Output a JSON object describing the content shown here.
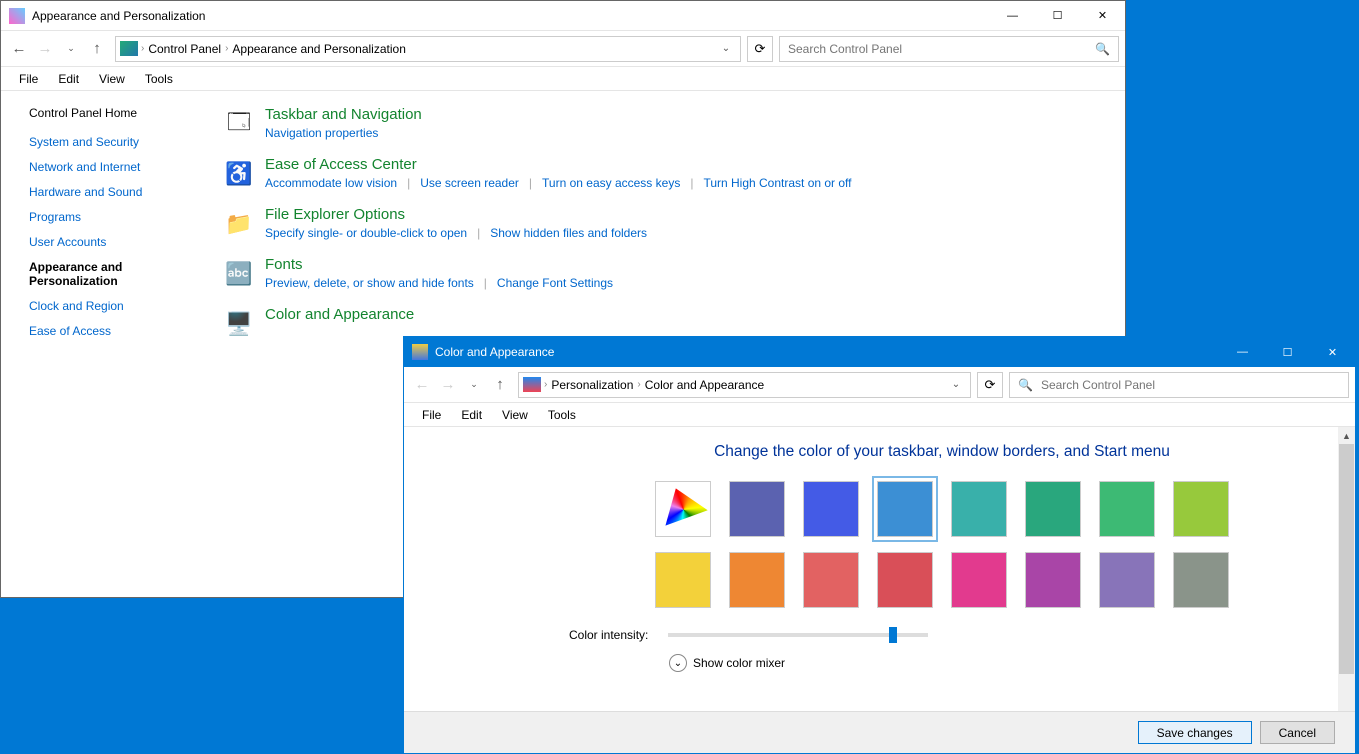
{
  "main_window": {
    "title": "Appearance and Personalization",
    "breadcrumb": {
      "root": "Control Panel",
      "current": "Appearance and Personalization"
    },
    "search_placeholder": "Search Control Panel",
    "menu": {
      "file": "File",
      "edit": "Edit",
      "view": "View",
      "tools": "Tools"
    },
    "sidebar": {
      "home": "Control Panel Home",
      "items": [
        "System and Security",
        "Network and Internet",
        "Hardware and Sound",
        "Programs",
        "User Accounts",
        "Appearance and Personalization",
        "Clock and Region",
        "Ease of Access"
      ]
    },
    "categories": [
      {
        "title": "Taskbar and Navigation",
        "links": [
          "Navigation properties"
        ]
      },
      {
        "title": "Ease of Access Center",
        "links": [
          "Accommodate low vision",
          "Use screen reader",
          "Turn on easy access keys",
          "Turn High Contrast on or off"
        ]
      },
      {
        "title": "File Explorer Options",
        "links": [
          "Specify single- or double-click to open",
          "Show hidden files and folders"
        ]
      },
      {
        "title": "Fonts",
        "links": [
          "Preview, delete, or show and hide fonts",
          "Change Font Settings"
        ]
      },
      {
        "title": "Color and Appearance",
        "links": []
      }
    ]
  },
  "sub_window": {
    "title": "Color and Appearance",
    "breadcrumb": {
      "seg1": "Personalization",
      "seg2": "Color and Appearance"
    },
    "search_placeholder": "Search Control Panel",
    "menu": {
      "file": "File",
      "edit": "Edit",
      "view": "View",
      "tools": "Tools"
    },
    "heading": "Change the color of your taskbar, window borders, and Start menu",
    "swatches": [
      {
        "name": "automatic",
        "color": "auto"
      },
      {
        "name": "indigo",
        "color": "#5b62b0"
      },
      {
        "name": "blue",
        "color": "#445be6"
      },
      {
        "name": "sky-blue",
        "color": "#3c8fd4",
        "selected": true
      },
      {
        "name": "teal",
        "color": "#39b0aa"
      },
      {
        "name": "sea-green",
        "color": "#29a77d"
      },
      {
        "name": "green",
        "color": "#3dba74"
      },
      {
        "name": "lime",
        "color": "#97c93c"
      },
      {
        "name": "yellow",
        "color": "#f3d13a"
      },
      {
        "name": "orange",
        "color": "#ee8733"
      },
      {
        "name": "coral",
        "color": "#e26262"
      },
      {
        "name": "red",
        "color": "#d94f58"
      },
      {
        "name": "magenta",
        "color": "#e23a8e"
      },
      {
        "name": "purple",
        "color": "#a945a7"
      },
      {
        "name": "violet",
        "color": "#8874b9"
      },
      {
        "name": "gray",
        "color": "#8a948a"
      }
    ],
    "intensity_label": "Color intensity:",
    "intensity_value": 85,
    "mixer_label": "Show color mixer",
    "buttons": {
      "save": "Save changes",
      "cancel": "Cancel"
    }
  }
}
